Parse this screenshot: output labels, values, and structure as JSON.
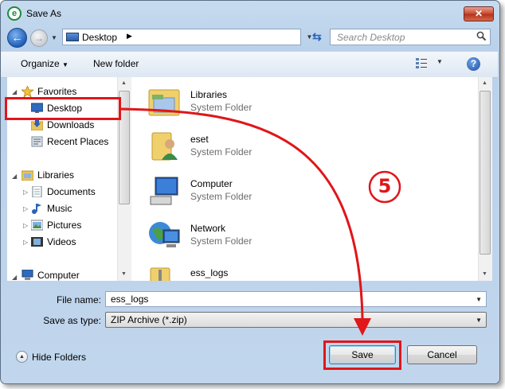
{
  "window": {
    "title": "Save As",
    "close_glyph": "✕"
  },
  "address_bar": {
    "location": "Desktop",
    "separator": "▶",
    "search_placeholder": "Search Desktop"
  },
  "toolbar": {
    "organize": "Organize",
    "dropdown_glyph": "▼",
    "new_folder": "New folder",
    "help_glyph": "?"
  },
  "nav_pane": {
    "favorites": "Favorites",
    "favorites_items": [
      "Desktop",
      "Downloads",
      "Recent Places"
    ],
    "libraries": "Libraries",
    "libraries_items": [
      "Documents",
      "Music",
      "Pictures",
      "Videos"
    ],
    "computer": "Computer"
  },
  "files": [
    {
      "name": "Libraries",
      "type": "System Folder",
      "icon": "libraries-icon"
    },
    {
      "name": "eset",
      "type": "System Folder",
      "icon": "user-folder-icon"
    },
    {
      "name": "Computer",
      "type": "System Folder",
      "icon": "computer-icon"
    },
    {
      "name": "Network",
      "type": "System Folder",
      "icon": "network-icon"
    },
    {
      "name": "ess_logs",
      "type": "",
      "icon": "zip-folder-icon"
    }
  ],
  "form": {
    "file_name_label": "File name:",
    "file_name_value": "ess_logs",
    "save_as_type_label": "Save as type:",
    "save_as_type_value": "ZIP Archive (*.zip)"
  },
  "footer": {
    "hide_folders": "Hide Folders",
    "save": "Save",
    "cancel": "Cancel"
  },
  "annotation": {
    "step_number": "5",
    "color": "#e0161a"
  }
}
